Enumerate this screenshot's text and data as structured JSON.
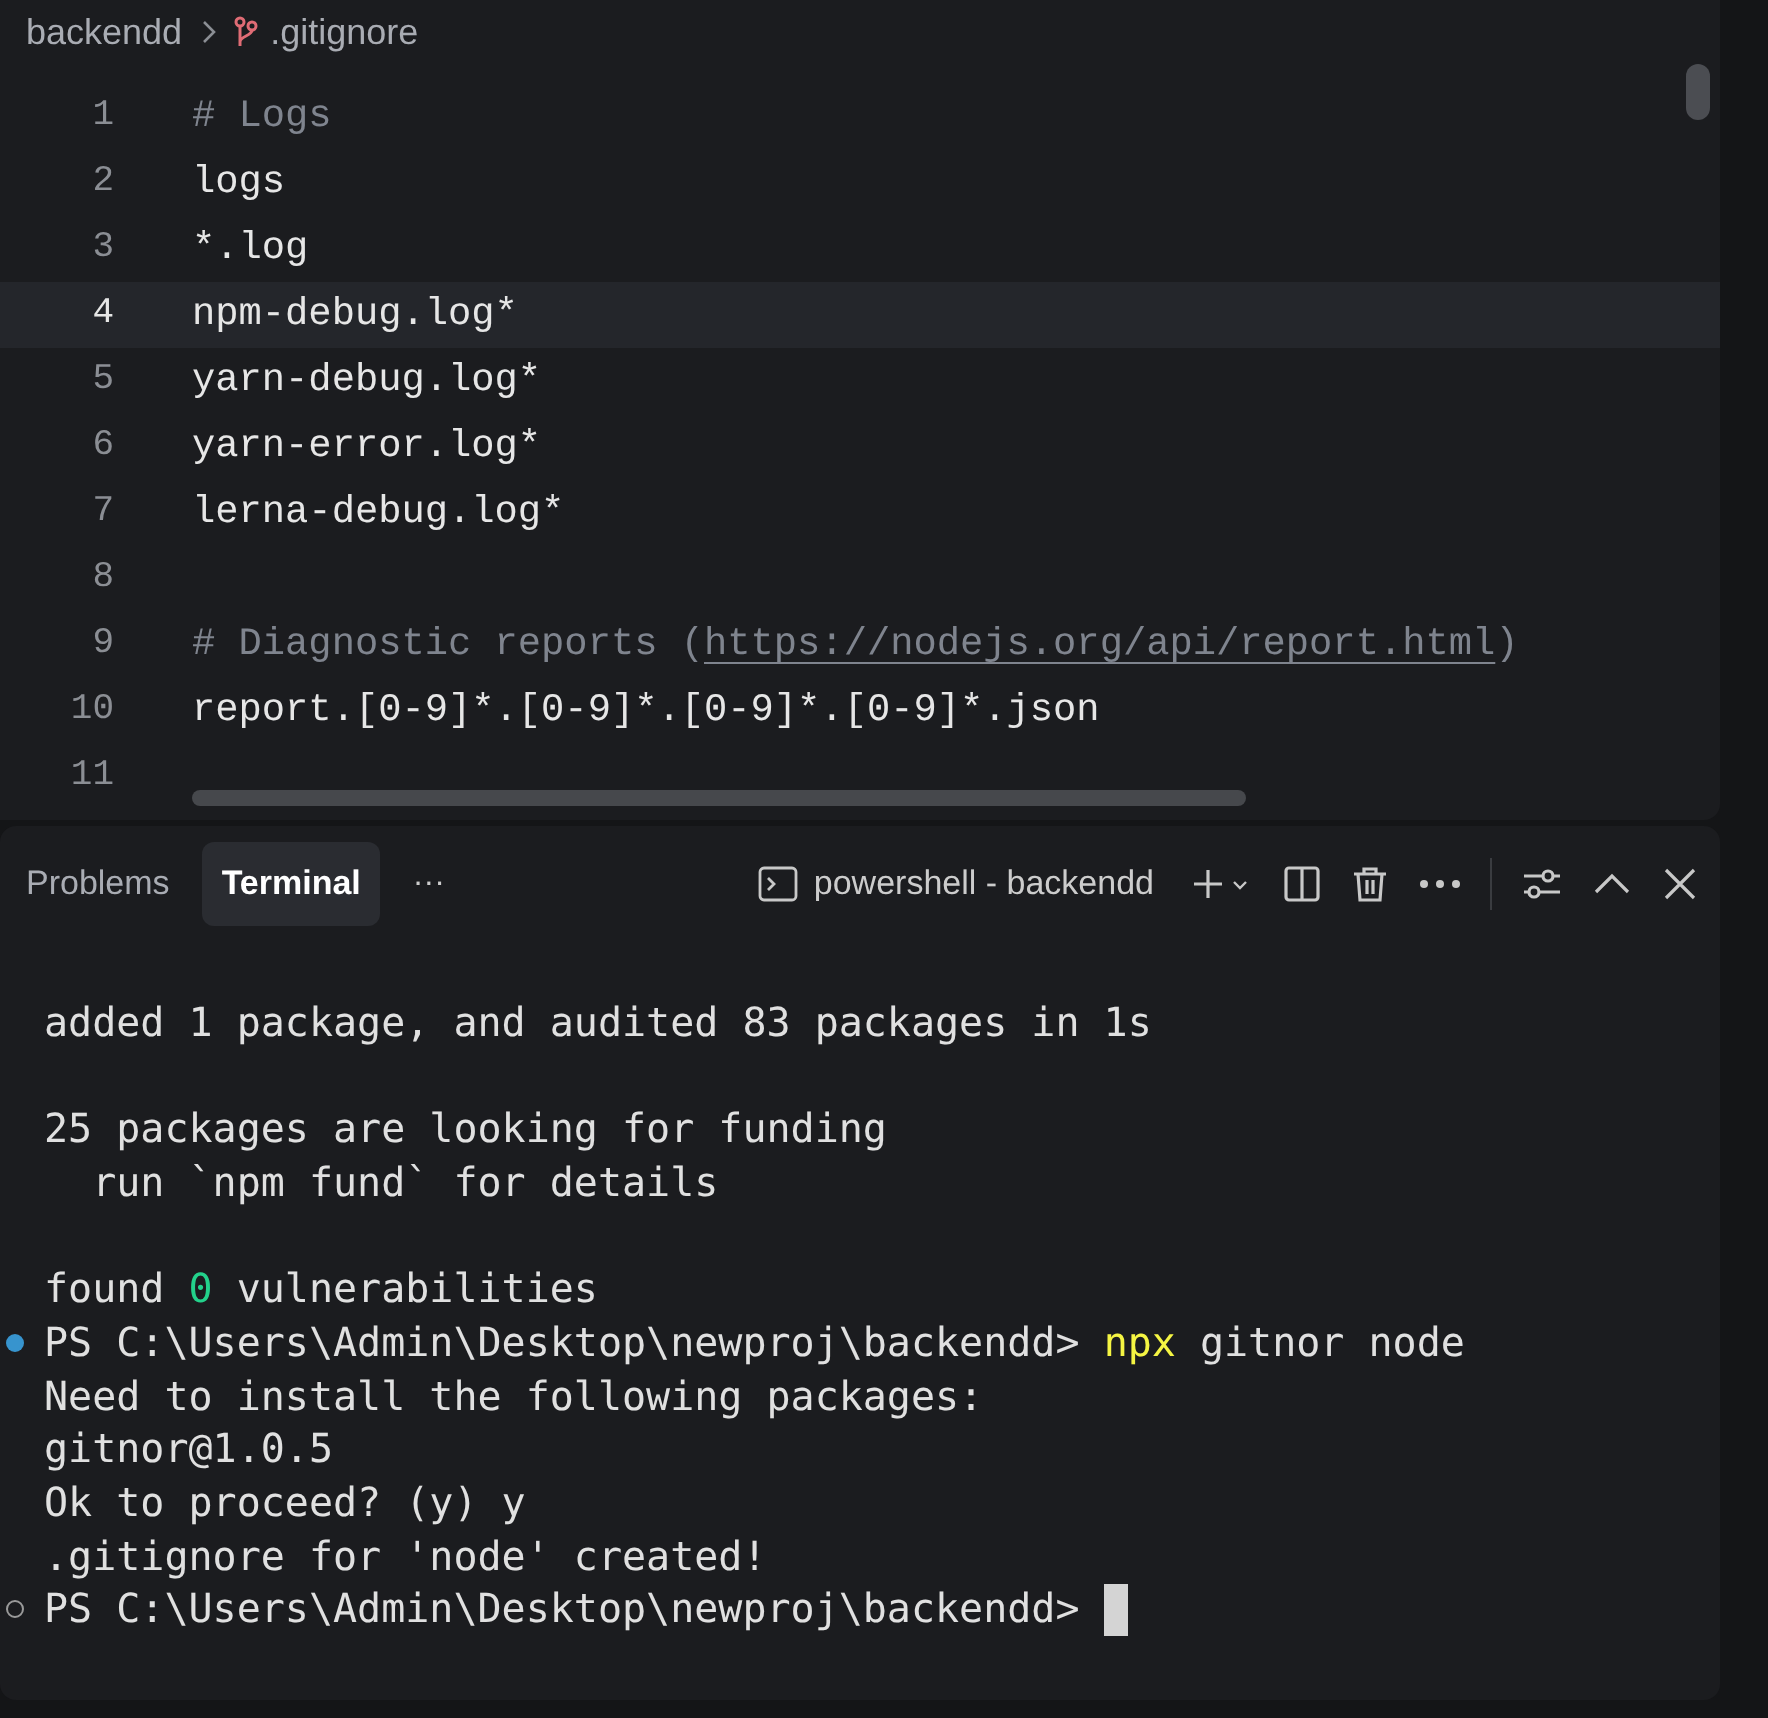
{
  "breadcrumb": [
    {
      "label": "backendd",
      "kind": "folder"
    },
    {
      "label": ".gitignore",
      "kind": "git-file"
    }
  ],
  "editor": {
    "lines": [
      {
        "number": "1",
        "current": false,
        "parts": [
          {
            "text": "# Logs",
            "kind": "comment"
          }
        ]
      },
      {
        "number": "2",
        "current": false,
        "parts": [
          {
            "text": "logs",
            "kind": "plain"
          }
        ]
      },
      {
        "number": "3",
        "current": false,
        "parts": [
          {
            "text": "*.log",
            "kind": "plain"
          }
        ]
      },
      {
        "number": "4",
        "current": true,
        "parts": [
          {
            "text": "npm-debug.log*",
            "kind": "plain"
          }
        ]
      },
      {
        "number": "5",
        "current": false,
        "parts": [
          {
            "text": "yarn-debug.log*",
            "kind": "plain"
          }
        ]
      },
      {
        "number": "6",
        "current": false,
        "parts": [
          {
            "text": "yarn-error.log*",
            "kind": "plain"
          }
        ]
      },
      {
        "number": "7",
        "current": false,
        "parts": [
          {
            "text": "lerna-debug.log*",
            "kind": "plain"
          }
        ]
      },
      {
        "number": "8",
        "current": false
      },
      {
        "number": "9",
        "current": false,
        "parts": [
          {
            "text": "# Diagnostic reports (",
            "kind": "comment"
          },
          {
            "text": "https://nodejs.org/api/report.html",
            "kind": "link"
          },
          {
            "text": ")",
            "kind": "comment"
          }
        ]
      },
      {
        "number": "10",
        "current": false,
        "parts": [
          {
            "text": "report.[0-9]*.[0-9]*.[0-9]*.[0-9]*.json",
            "kind": "plain"
          }
        ]
      },
      {
        "number": "11",
        "current": false
      }
    ]
  },
  "panel": {
    "tabs": [
      {
        "label": "Problems",
        "selected": false
      },
      {
        "label": "Terminal",
        "selected": true
      }
    ],
    "more": "···",
    "terminal_name": "powershell - backendd",
    "terminal": [
      {
        "lines": [
          {
            "parts": [
              {
                "text": "added 1 package, and audited 83 packages in 1s",
                "kind": "plain"
              }
            ]
          }
        ]
      },
      {
        "lines": [
          {
            "parts": [
              {
                "text": "25 packages are looking for funding",
                "kind": "plain"
              }
            ]
          },
          {
            "parts": [
              {
                "text": "  run `npm fund` for details",
                "kind": "plain"
              }
            ]
          }
        ]
      },
      {
        "lines": [
          {
            "parts": [
              {
                "text": "found ",
                "kind": "plain"
              },
              {
                "text": "0",
                "kind": "number"
              },
              {
                "text": " vulnerabilities",
                "kind": "plain"
              }
            ]
          },
          {
            "succeeded": true,
            "parts": [
              {
                "text": "PS C:\\Users\\Admin\\Desktop\\newproj\\backendd> ",
                "kind": "plain"
              },
              {
                "text": "npx",
                "kind": "command"
              },
              {
                "text": " gitnor node",
                "kind": "plain"
              }
            ]
          },
          {
            "parts": [
              {
                "text": "Need to install the following packages:",
                "kind": "plain"
              }
            ]
          },
          {
            "parts": [
              {
                "text": "gitnor@1.0.5",
                "kind": "plain"
              }
            ]
          },
          {
            "parts": [
              {
                "text": "Ok to proceed? (y) y",
                "kind": "plain"
              }
            ]
          },
          {
            "parts": [
              {
                "text": ".gitignore for 'node' created!",
                "kind": "plain"
              }
            ]
          },
          {
            "succeeded": false,
            "parts": [
              {
                "text": "PS C:\\Users\\Admin\\Desktop\\newproj\\backendd> ",
                "kind": "plain"
              }
            ],
            "cursor": true
          }
        ]
      }
    ]
  }
}
